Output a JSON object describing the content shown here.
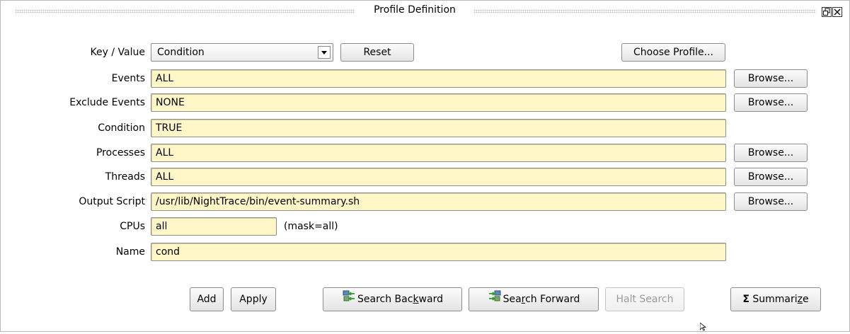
{
  "window": {
    "title": "Profile Definition",
    "float_icon": "float-icon",
    "close_icon": "close-icon"
  },
  "key_value": {
    "label": "Key / Value",
    "selected": "Condition",
    "reset_label": "Reset",
    "choose_profile_label": "Choose Profile..."
  },
  "fields": {
    "events": {
      "label": "Events",
      "value": "ALL",
      "browse": "Browse..."
    },
    "exclude_events": {
      "label": "Exclude Events",
      "value": "NONE",
      "browse": "Browse..."
    },
    "condition": {
      "label": "Condition",
      "value": "TRUE"
    },
    "processes": {
      "label": "Processes",
      "value": "ALL",
      "browse": "Browse..."
    },
    "threads": {
      "label": "Threads",
      "value": "ALL",
      "browse": "Browse..."
    },
    "output_script": {
      "label": "Output Script",
      "value": "/usr/lib/NightTrace/bin/event-summary.sh",
      "browse": "Browse..."
    },
    "cpus": {
      "label": "CPUs",
      "value": "all",
      "mask_text": "(mask=all)"
    },
    "name": {
      "label": "Name",
      "value": "cond"
    }
  },
  "actions": {
    "add": "Add",
    "apply": "Apply",
    "search_backward": {
      "pre": "Search Bac",
      "ul": "k",
      "post": "ward"
    },
    "search_forward": {
      "pre": "Sea",
      "ul": "r",
      "post": "ch Forward"
    },
    "halt_search": "Halt Search",
    "summarize": {
      "symbol": "Σ",
      "pre": "Summari",
      "ul": "z",
      "post": "e"
    }
  },
  "colors": {
    "field_bg": "#fff6c8",
    "field_border": "#8e8e8e",
    "button_border": "#8c8c8c"
  }
}
